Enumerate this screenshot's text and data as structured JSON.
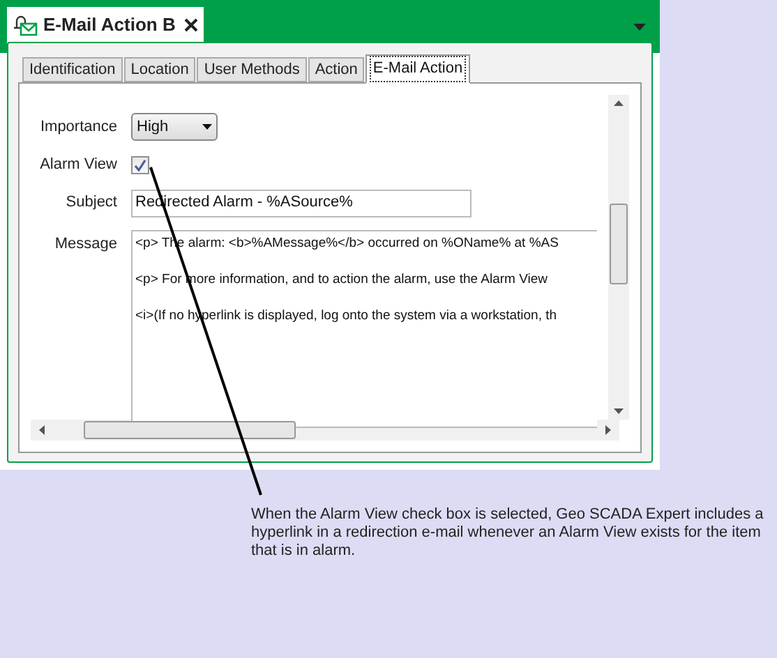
{
  "window": {
    "title": "E-Mail Action B"
  },
  "tabs": [
    {
      "label": "Identification",
      "selected": false
    },
    {
      "label": "Location",
      "selected": false
    },
    {
      "label": "User Methods",
      "selected": false
    },
    {
      "label": "Action",
      "selected": false
    },
    {
      "label": "E-Mail Action",
      "selected": true
    }
  ],
  "form": {
    "importance": {
      "label": "Importance",
      "value": "High"
    },
    "alarm_view": {
      "label": "Alarm View",
      "checked": true
    },
    "subject": {
      "label": "Subject",
      "value": "Redirected Alarm - %ASource%"
    },
    "message": {
      "label": "Message",
      "lines": [
        "<p> The alarm: <b>%AMessage%</b> occurred on %OName% at %AS",
        "<p> For more information, and to action the alarm, use the Alarm View",
        "<i>(If no hyperlink is displayed, log onto the system via a workstation, th"
      ]
    }
  },
  "callout": "When the Alarm View check box is selected, Geo SCADA Expert includes a hyperlink in a redirection e-mail whenever an Alarm View exists for the item that is in alarm."
}
